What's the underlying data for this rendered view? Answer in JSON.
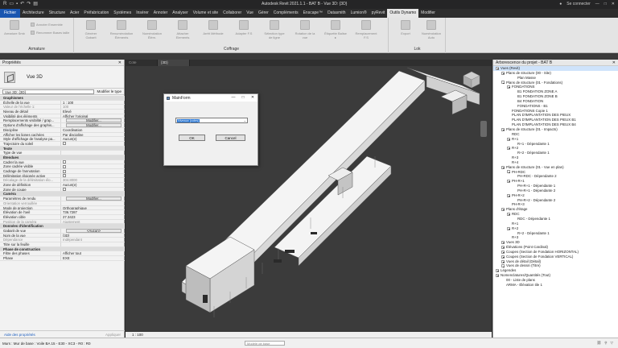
{
  "window": {
    "title": "Autodesk Revit 2021.1.1 - BAT B - Vue 3D: {3D}",
    "user": "Se connecter",
    "controls": [
      "—",
      "□",
      "✕"
    ]
  },
  "menu": {
    "file": "Fichier",
    "tabs": [
      "Architecture",
      "Structure",
      "Acier",
      "Préfabrication",
      "Systèmes",
      "Insérer",
      "Annoter",
      "Analyser",
      "Volume et site",
      "Collaborer",
      "Vue",
      "Gérer",
      "Compléments",
      "Enscape™",
      "Datasmith",
      "Lumion®",
      "pyRevit",
      "Outils Dynamo",
      "Modifier"
    ],
    "active_index": 17
  },
  "ribbon": {
    "groups": [
      {
        "label": "Armature",
        "buttons": [
          "Armature Smb"
        ],
        "small": [
          "Annoter Ensemble",
          "Renommer Bases taille"
        ]
      },
      {
        "label": "Coffrage",
        "buttons": [
          "Générer Gabarit",
          "Renumérotation Éléments",
          "Numérotation Élém.",
          "Attacher Elements",
          "Arrêt Méthode",
          "Adapter F.S",
          "Sélection type de ligne",
          "Rotation de la vue",
          "Étiquette Balise ▸",
          "Remplacement F.S"
        ]
      },
      {
        "label": "Lok",
        "buttons": [
          "Export",
          "Numérotation Auto"
        ]
      }
    ]
  },
  "properties": {
    "title": "Propriétés",
    "type_name": "Vue 3D",
    "selector_value": "Vue 3D: {3D}",
    "edit_type_label": "Modifier le type",
    "rows": [
      {
        "kind": "sec",
        "name": "Graphismes"
      },
      {
        "name": "Échelle de la vue",
        "value": "1 : 100"
      },
      {
        "name": "Valeur de l'échelle    1:",
        "value": "100",
        "ro": true
      },
      {
        "name": "Niveau de détail",
        "value": "Elevé"
      },
      {
        "name": "Visibilité des éléments",
        "value": "Afficher l'original"
      },
      {
        "name": "Remplacements visibilité / grap...",
        "value": "Modifier...",
        "btn": true
      },
      {
        "name": "Options d'affichage des graphis...",
        "value": "Modifier...",
        "btn": true
      },
      {
        "name": "Discipline",
        "value": "Coordination"
      },
      {
        "name": "Afficher les lignes cachées",
        "value": "Par discipline"
      },
      {
        "name": "Style d'affichage de l'analyse pa...",
        "value": "Aucun(e)"
      },
      {
        "name": "Trajectoire du soleil",
        "value": "",
        "chk": true
      },
      {
        "kind": "sec",
        "name": "Texte"
      },
      {
        "name": "Type de vue",
        "value": ""
      },
      {
        "kind": "sec",
        "name": "Étendues"
      },
      {
        "name": "Cadrer la vue",
        "value": "",
        "chk": true
      },
      {
        "name": "Zone cadrée visible",
        "value": "",
        "chk": true
      },
      {
        "name": "Cadrage de l'annotation",
        "value": "",
        "chk": true
      },
      {
        "name": "Délimitation éloignée active",
        "value": "",
        "chk": true
      },
      {
        "name": "Décalage de la délimitation élo...",
        "value": "304.8000",
        "ro": true
      },
      {
        "name": "Zone de définition",
        "value": "Aucun(e)"
      },
      {
        "name": "Zone de coupe",
        "value": "",
        "chk": true
      },
      {
        "kind": "sec",
        "name": "Caméra"
      },
      {
        "name": "Paramètres de rendu",
        "value": "Modifier...",
        "btn": true
      },
      {
        "name": "Orientation verrouillée",
        "value": "",
        "ro": true
      },
      {
        "name": "Mode de projection",
        "value": "Orthographique"
      },
      {
        "name": "Élévation de l'oeil",
        "value": "736.7287"
      },
      {
        "name": "Élévation cible",
        "value": "27.3423"
      },
      {
        "name": "Position de la caméra",
        "value": "Ajustement",
        "ro": true
      },
      {
        "kind": "sec",
        "name": "Données d'identification"
      },
      {
        "name": "Gabarit de vue",
        "value": "<Aucun>",
        "btn": true
      },
      {
        "name": "Nom de la vue",
        "value": "{3D}"
      },
      {
        "name": "Dépendance",
        "value": "Indépendant",
        "ro": true
      },
      {
        "name": "Titre sur la feuille",
        "value": ""
      },
      {
        "kind": "sec",
        "name": "Phase de construction"
      },
      {
        "name": "Filtre des phases",
        "value": "Afficher tout"
      },
      {
        "name": "Phase",
        "value": "EXE"
      }
    ],
    "help_link": "Aide des propriétés",
    "apply_label": "Appliquer"
  },
  "view": {
    "tabs": [
      "Cote",
      "{3D}"
    ],
    "active_tab": 1,
    "scale_text": "1 : 100"
  },
  "dialog": {
    "title": "MainForm",
    "combo_value": "Niveaux (cotes)",
    "ok_label": "OK",
    "cancel_label": "Cancel"
  },
  "browser": {
    "title": "Arborescence du projet - BAT B",
    "selected_index": 0,
    "items": [
      {
        "d": 0,
        "t": "Vues (Revit)",
        "tg": true
      },
      {
        "d": 1,
        "t": "Plans de structure (00 - Site)",
        "tg": true
      },
      {
        "d": 3,
        "t": "Plan Masse"
      },
      {
        "d": 1,
        "t": "Plans de structure (01 - Fondations)",
        "tg": true
      },
      {
        "d": 2,
        "t": "FONDATIONS",
        "tg": true
      },
      {
        "d": 3,
        "t": "B1 FONDATION ZONE A"
      },
      {
        "d": 3,
        "t": "B1 FONDATION ZONE B"
      },
      {
        "d": 3,
        "t": "B4 FONDATION"
      },
      {
        "d": 3,
        "t": "FONDATIONS - B1"
      },
      {
        "d": 2,
        "t": "FONDATIONS Copie 1"
      },
      {
        "d": 2,
        "t": "PLAN D'IMPLANTATION DES PIEUX"
      },
      {
        "d": 2,
        "t": "PLAN D'IMPLANTATION DES PIEUX B1"
      },
      {
        "d": 2,
        "t": "PLAN D'IMPLANTATION DES PIEUX B4"
      },
      {
        "d": 1,
        "t": "Plans de structure (01 - Impacts)",
        "tg": true
      },
      {
        "d": 2,
        "t": "RDC"
      },
      {
        "d": 2,
        "t": "R+1",
        "tg": true
      },
      {
        "d": 3,
        "t": "R+1 - Dépendante 1"
      },
      {
        "d": 2,
        "t": "R+2",
        "tg": true
      },
      {
        "d": 3,
        "t": "R+2 - Dépendante 1"
      },
      {
        "d": 2,
        "t": "R+3"
      },
      {
        "d": 2,
        "t": "R+4"
      },
      {
        "d": 1,
        "t": "Plans de structure (01 - Vue en plan)",
        "tg": true
      },
      {
        "d": 2,
        "t": "PH-RDC",
        "tg": true
      },
      {
        "d": 3,
        "t": "PH-RDC - Dépendante 2"
      },
      {
        "d": 2,
        "t": "PH-R+1",
        "tg": true
      },
      {
        "d": 3,
        "t": "PH-R+1 - Dépendante 1"
      },
      {
        "d": 3,
        "t": "PH-R+1 - Dépendante 2"
      },
      {
        "d": 2,
        "t": "PH-R+2",
        "tg": true
      },
      {
        "d": 3,
        "t": "PH-R+2 - Dépendante 2"
      },
      {
        "d": 2,
        "t": "PH-R+3"
      },
      {
        "d": 1,
        "t": "Plans d'étage",
        "tg": true
      },
      {
        "d": 2,
        "t": "RDC",
        "tg": true
      },
      {
        "d": 3,
        "t": "RDC - Dépendante 1"
      },
      {
        "d": 2,
        "t": "R+1"
      },
      {
        "d": 2,
        "t": "R+2",
        "tg": true
      },
      {
        "d": 3,
        "t": "R+2 - Dépendante 1"
      },
      {
        "d": 2,
        "t": "R+3"
      },
      {
        "d": 1,
        "t": "Vues 3D",
        "tg": true
      },
      {
        "d": 1,
        "t": "Élévations (Point Cardinal)",
        "tg": true
      },
      {
        "d": 1,
        "t": "Coupes (Section de Fondation HORIZONTAL)",
        "tg": true
      },
      {
        "d": 1,
        "t": "Coupes (Section de Fondation VERTICAL)",
        "tg": true
      },
      {
        "d": 1,
        "t": "Vues de détail (Détail)",
        "tg": true
      },
      {
        "d": 1,
        "t": "Vues de dessin (Titre)",
        "tg": true
      },
      {
        "d": 0,
        "t": "Légendes",
        "tg": true
      },
      {
        "d": 0,
        "t": "Nomenclatures/Quantités (Tout)",
        "tg": true
      },
      {
        "d": 1,
        "t": "00 - Liste de plans"
      },
      {
        "d": 1,
        "t": "ARMA - Élévation tile 1"
      }
    ]
  },
  "statusbar": {
    "text": "Murs : Mur de base : Voile BA 15 - E30 - XC3 - R0 : R0",
    "field": "Modèle de base"
  }
}
